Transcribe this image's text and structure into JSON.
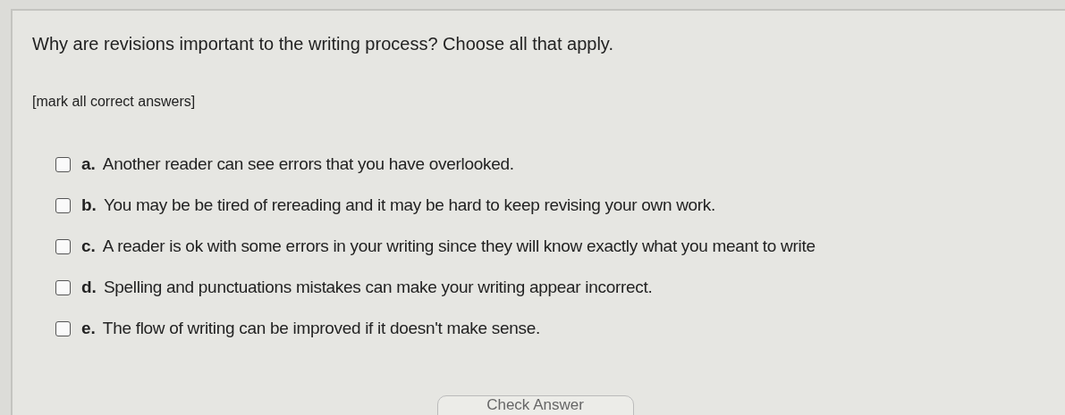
{
  "question": "Why are revisions important to the writing process? Choose all that apply.",
  "instruction": "[mark all correct answers]",
  "options": [
    {
      "letter": "a.",
      "text": "Another reader can see errors that you have overlooked.",
      "checked": false
    },
    {
      "letter": "b.",
      "text": "You may be be tired of rereading and it may be hard to keep revising your own work.",
      "checked": false
    },
    {
      "letter": "c.",
      "text": "A reader is ok with some errors in your writing since they will know exactly what you meant to write",
      "checked": false
    },
    {
      "letter": "d.",
      "text": "Spelling and punctuations mistakes can make your writing appear incorrect.",
      "checked": false
    },
    {
      "letter": "e.",
      "text": "The flow of writing can be improved if it doesn't make sense.",
      "checked": false
    }
  ],
  "check_button": "Check Answer"
}
